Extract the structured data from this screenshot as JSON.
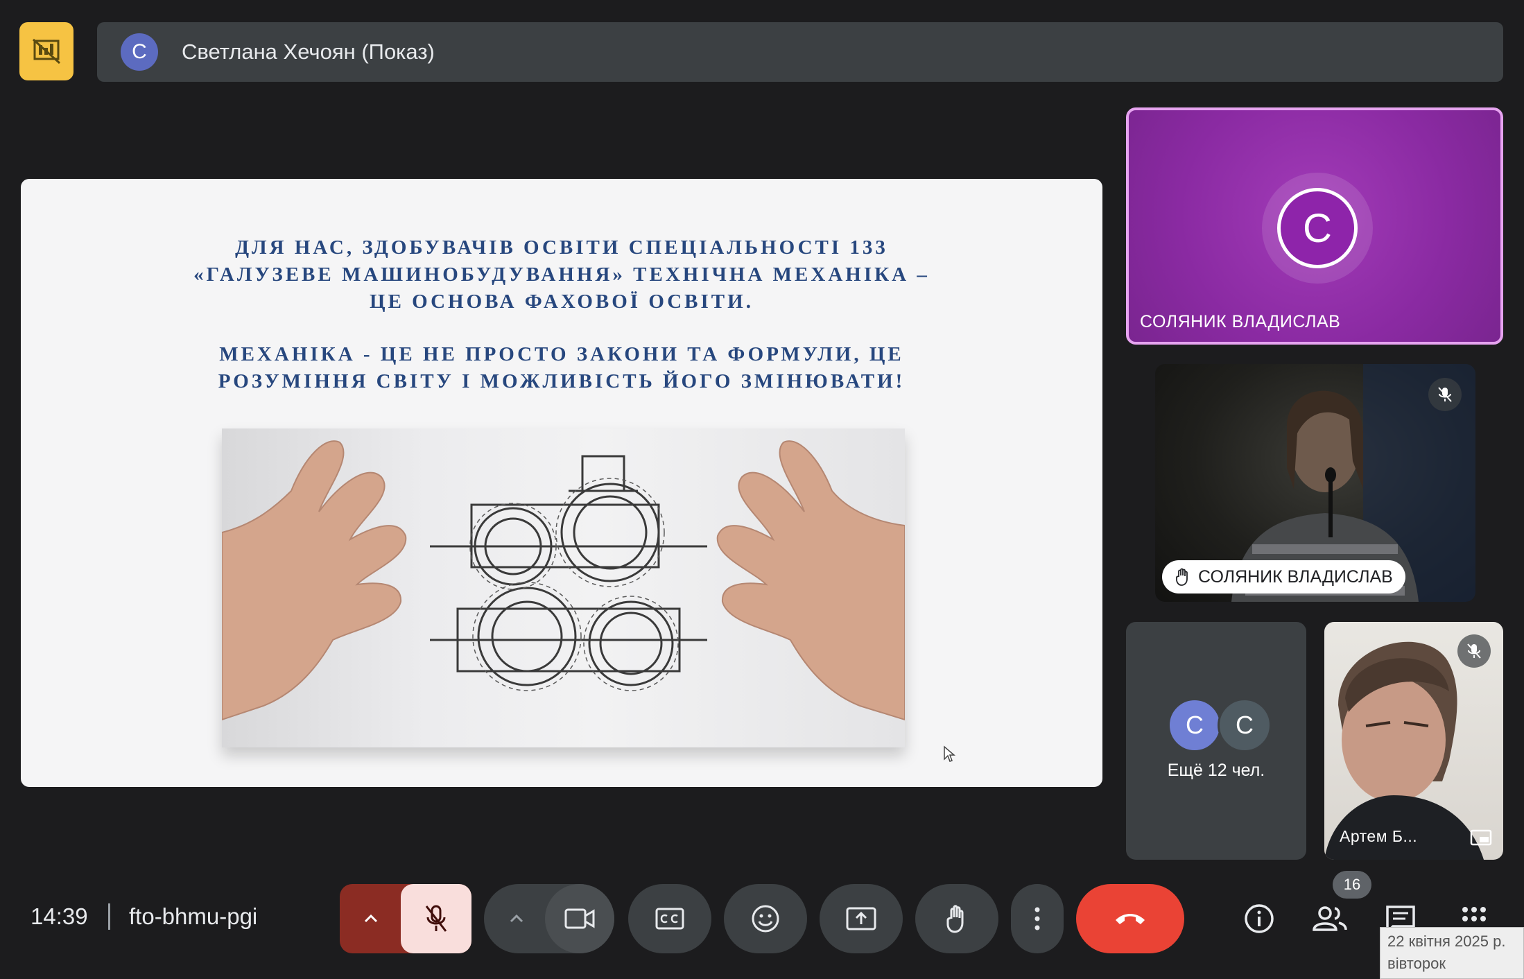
{
  "presenter_bar": {
    "avatar_letter": "С",
    "name": "Светлана Хечоян (Показ)"
  },
  "slide": {
    "paragraph_1_lines": [
      "ДЛЯ НАС, ЗДОБУВАЧІВ ОСВІТИ СПЕЦІАЛЬНОСТІ 133",
      "«ГАЛУЗЕВЕ МАШИНОБУДУВАННЯ» ТЕХНІЧНА МЕХАНІКА –",
      "ЦЕ ОСНОВА ФАХОВОЇ ОСВІТИ."
    ],
    "paragraph_2_lines": [
      "МЕХАНІКА - ЦЕ НЕ ПРОСТО ЗАКОНИ ТА ФОРМУЛИ, ЦЕ",
      "РОЗУМІННЯ СВІТУ І МОЖЛИВІСТЬ ЙОГО ЗМІНЮВАТИ!"
    ]
  },
  "tiles": {
    "featured": {
      "avatar_letter": "С",
      "name": "СОЛЯНИК ВЛАДИСЛАВ"
    },
    "video1": {
      "name": "СОЛЯНИК ВЛАДИСЛАВ"
    },
    "more": {
      "avatar_letters": [
        "С",
        "С"
      ],
      "label": "Ещё 12 чел."
    },
    "video2": {
      "name": "Артем Б..."
    }
  },
  "bottom_bar": {
    "time": "14:39",
    "meeting_code": "fto-bhmu-pgi",
    "participant_count": "16"
  },
  "date_tooltip": {
    "line1": "22 квітня 2025 р.",
    "line2": "вівторок"
  },
  "colors": {
    "presenting_toggle": "#f6c343",
    "end_call": "#ea4335",
    "mic_group": "#8b2c23",
    "featured_tile": "#8a2aa2",
    "slide_text": "#27477e"
  }
}
